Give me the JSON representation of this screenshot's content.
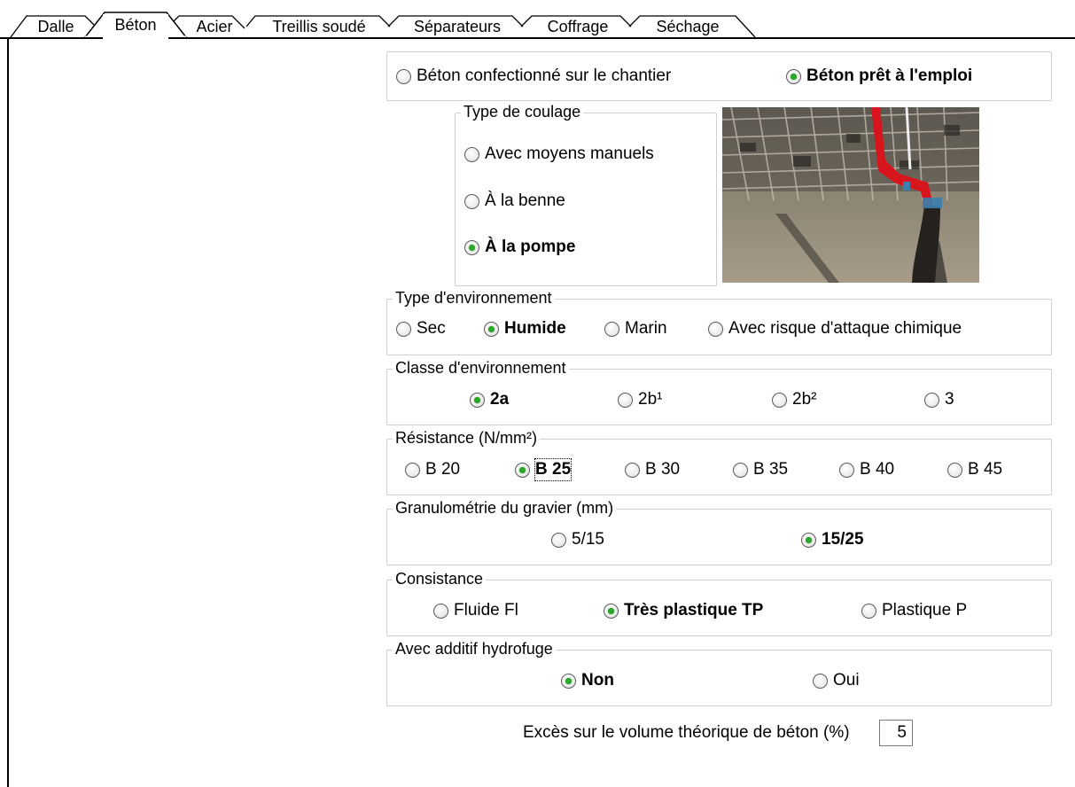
{
  "tabs": [
    "Dalle",
    "Béton",
    "Acier",
    "Treillis soudé",
    "Séparateurs",
    "Coffrage",
    "Séchage"
  ],
  "active_tab": "Béton",
  "production": {
    "options": [
      "Béton confectionné sur le chantier",
      "Béton prêt à l'emploi"
    ],
    "selected": "Béton prêt à l'emploi"
  },
  "pouring": {
    "legend": "Type de coulage",
    "options": [
      "Avec moyens manuels",
      "À la benne",
      "À la pompe"
    ],
    "selected": "À la pompe"
  },
  "environment_type": {
    "legend": "Type d'environnement",
    "options": [
      "Sec",
      "Humide",
      "Marin",
      "Avec risque d'attaque chimique"
    ],
    "selected": "Humide"
  },
  "environment_class": {
    "legend": "Classe d'environnement",
    "options": [
      "2a",
      "2b¹",
      "2b²",
      "3"
    ],
    "selected": "2a"
  },
  "strength": {
    "legend": "Résistance (N/mm²)",
    "options": [
      "B 20",
      "B 25",
      "B 30",
      "B 35",
      "B 40",
      "B 45"
    ],
    "selected": "B 25"
  },
  "gravel": {
    "legend": "Granulométrie du gravier (mm)",
    "options": [
      "5/15",
      "15/25"
    ],
    "selected": "15/25"
  },
  "consistency": {
    "legend": "Consistance",
    "options": [
      "Fluide Fl",
      "Très plastique TP",
      "Plastique P"
    ],
    "selected": "Très plastique TP"
  },
  "waterproofing": {
    "legend": "Avec additif hydrofuge",
    "options": [
      "Non",
      "Oui"
    ],
    "selected": "Non"
  },
  "excess": {
    "label": "Excès sur le volume théorique de béton (%)",
    "value": "5"
  },
  "colors": {
    "radio_dot": "#2aa82a",
    "pipe": "#d8141c",
    "border": "#d0d0d0"
  }
}
